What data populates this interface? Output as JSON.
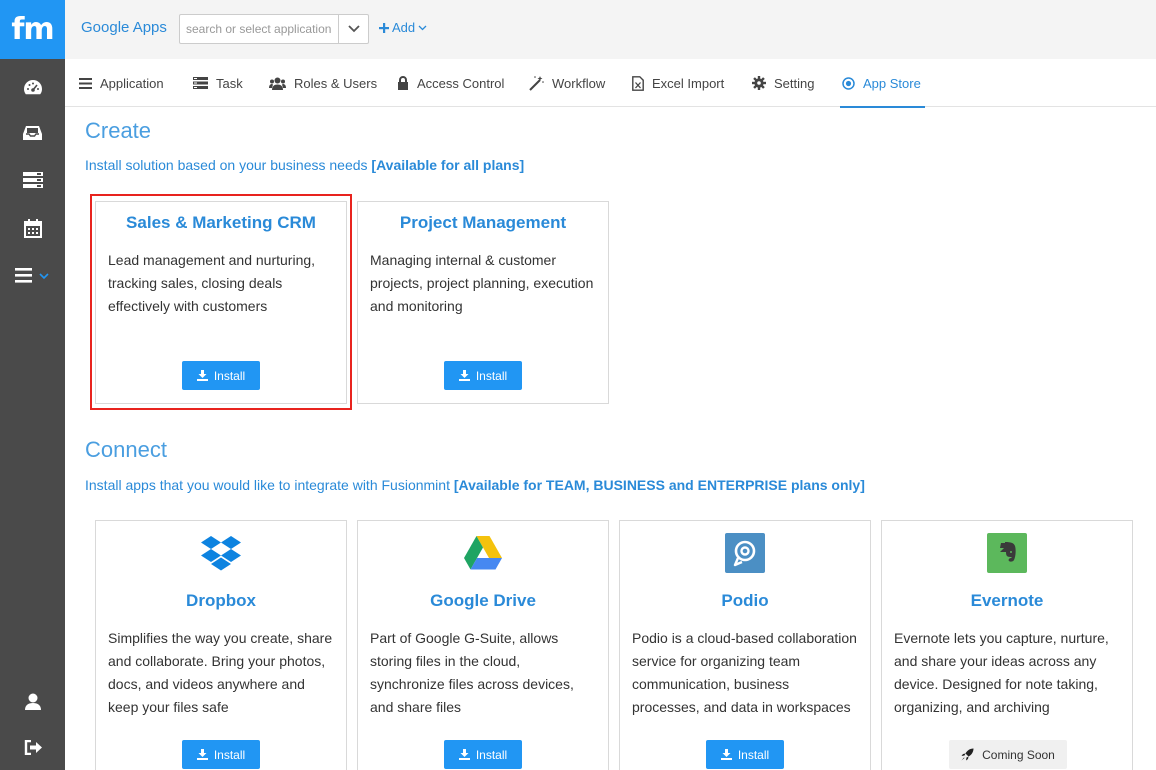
{
  "sidebar": {
    "logo": "fm",
    "items": [
      {
        "icon": "dashboard-icon"
      },
      {
        "icon": "inbox-icon"
      },
      {
        "icon": "server-icon"
      },
      {
        "icon": "calendar-icon"
      },
      {
        "icon": "menu-icon"
      }
    ],
    "bottom": [
      {
        "icon": "user-icon"
      },
      {
        "icon": "sign-out-icon"
      }
    ]
  },
  "topbar": {
    "app_name": "Google Apps",
    "search_placeholder": "search or select application",
    "add_label": "Add"
  },
  "tabs": [
    {
      "label": "Application",
      "icon": "list-icon"
    },
    {
      "label": "Task",
      "icon": "tasks-icon"
    },
    {
      "label": "Roles & Users",
      "icon": "users-icon"
    },
    {
      "label": "Access Control",
      "icon": "lock-icon"
    },
    {
      "label": "Workflow",
      "icon": "magic-icon"
    },
    {
      "label": "Excel Import",
      "icon": "excel-icon"
    },
    {
      "label": "Setting",
      "icon": "gear-icon"
    },
    {
      "label": "App Store",
      "icon": "dot-circle-icon",
      "active": true
    }
  ],
  "create": {
    "title": "Create",
    "subtitle_prefix": "Install solution based on your business needs ",
    "subtitle_bold": "[Available for all plans]",
    "cards": [
      {
        "title": "Sales & Marketing CRM",
        "desc": "Lead management and nurturing, tracking sales, closing deals effectively with customers",
        "button": "Install"
      },
      {
        "title": "Project Management",
        "desc": "Managing internal & customer projects, project planning, execution and monitoring",
        "button": "Install"
      }
    ]
  },
  "connect": {
    "title": "Connect",
    "subtitle_prefix": "Install apps that you would like to integrate with Fusionmint ",
    "subtitle_bold": "[Available for TEAM, BUSINESS and ENTERPRISE plans only]",
    "cards": [
      {
        "title": "Dropbox",
        "icon": "dropbox-icon",
        "desc": "Simplifies the way you create, share and collaborate. Bring your photos, docs, and videos anywhere and keep your files safe",
        "button": "Install"
      },
      {
        "title": "Google Drive",
        "icon": "google-drive-icon",
        "desc": "Part of Google G-Suite, allows storing files in the cloud, synchronize files across devices, and share files",
        "button": "Install"
      },
      {
        "title": "Podio",
        "icon": "podio-icon",
        "desc": "Podio is a cloud-based collaboration service for organizing team communication, business processes, and data in workspaces",
        "button": "Install"
      },
      {
        "title": "Evernote",
        "icon": "evernote-icon",
        "desc": "Evernote lets you capture, nurture, and share your ideas across any device. Designed for note taking, organizing, and archiving",
        "button": "Coming Soon"
      }
    ]
  },
  "colors": {
    "accent": "#2196f3",
    "link": "#2a8ad8",
    "sidebar": "#4a4a4a",
    "highlight": "#e8231e"
  }
}
